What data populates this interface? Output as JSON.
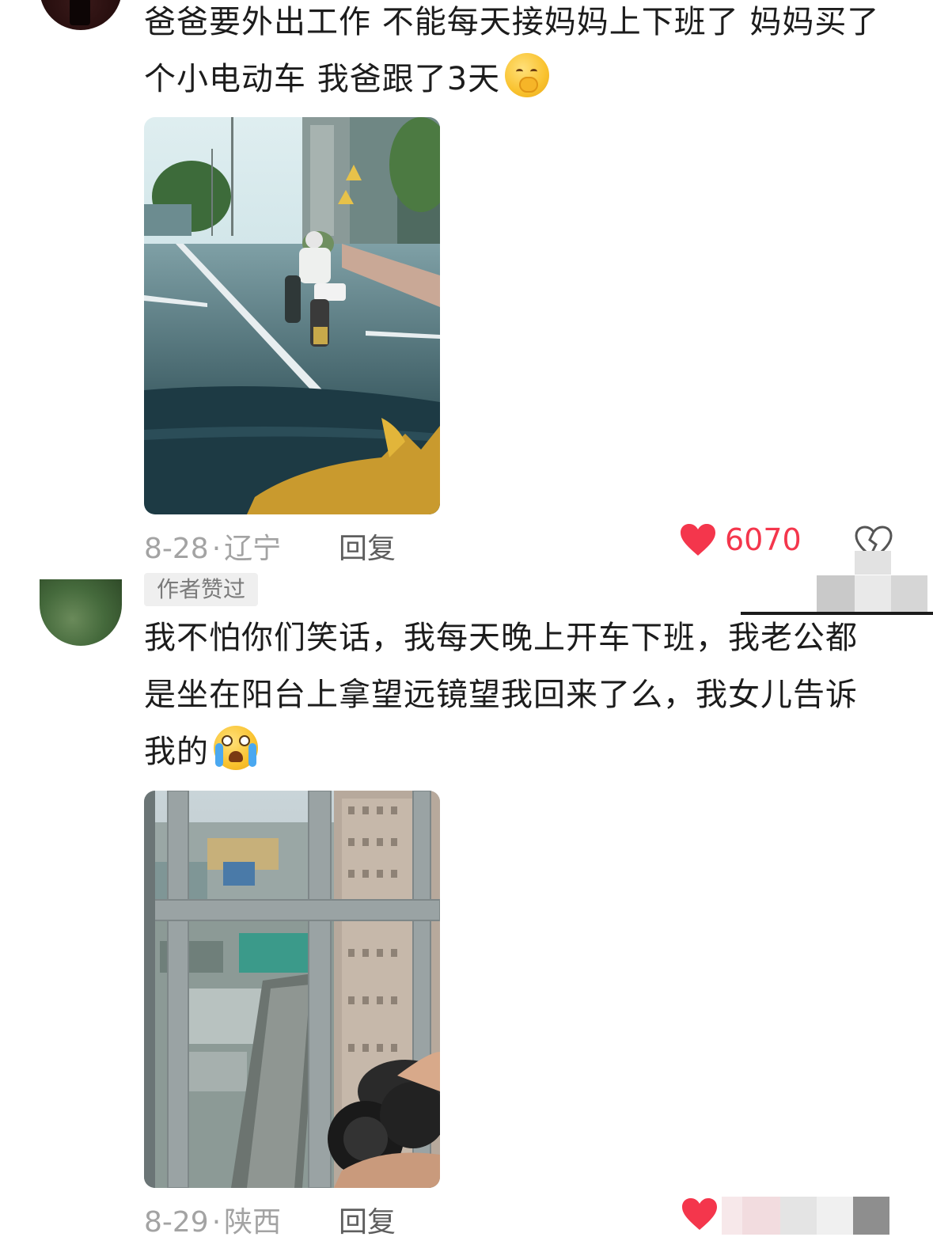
{
  "comments": [
    {
      "text": "爸爸要外出工作 不能每天接妈妈上下班了 妈妈买了个小电动车 我爸跟了3天",
      "emoji": "shy-face-emoji",
      "date": "8-28",
      "location": "辽宁",
      "reply_label": "回复",
      "likes": "6070",
      "author_badge": "作者赞过",
      "image_alt": "street-scooter-photo",
      "colors": {
        "heart": "#f4364c"
      }
    },
    {
      "text": "我不怕你们笑话，我每天晚上开车下班，我老公都是坐在阳台上拿望远镜望我回来了么，我女儿告诉我的",
      "emoji": "crying-laughing-emoji",
      "date": "8-29",
      "location": "陕西",
      "reply_label": "回复",
      "image_alt": "balcony-binoculars-photo"
    }
  ],
  "icons": [
    "heart-icon",
    "dislike-icon"
  ]
}
